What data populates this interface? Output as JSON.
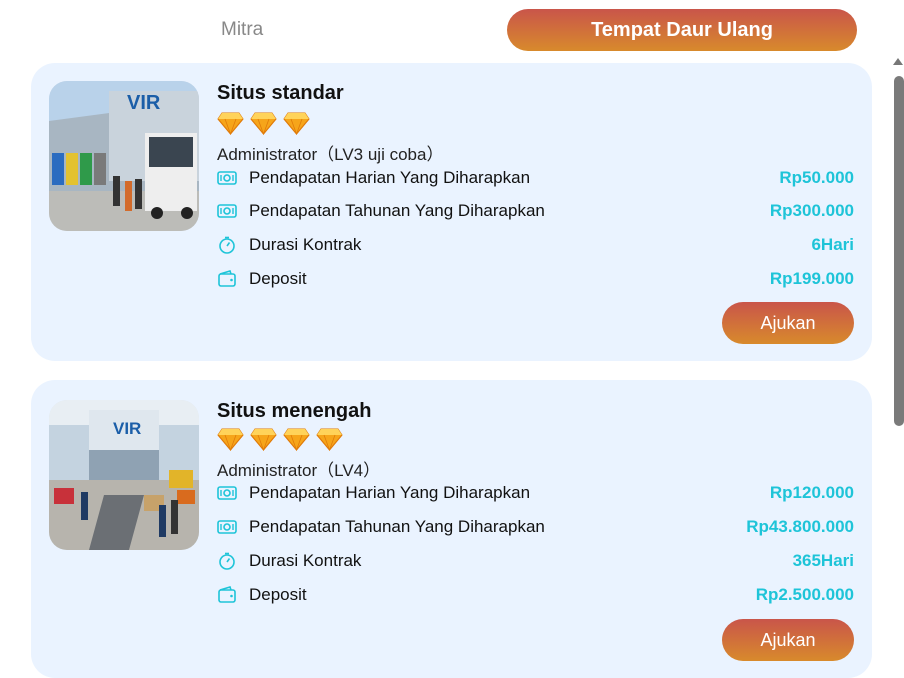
{
  "tabs": {
    "mitra": "Mitra",
    "recycling": "Tempat Daur Ulang"
  },
  "colors": {
    "accent_from": "#c9554a",
    "accent_to": "#d88a2c",
    "value": "#1ec4d8",
    "card_bg": "#eaf3ff"
  },
  "sites": [
    {
      "title": "Situs standar",
      "gems": 3,
      "admin": "Administrator（LV3 uji coba）",
      "rows": [
        {
          "icon": "cash-icon",
          "label": "Pendapatan Harian Yang Diharapkan",
          "value": "Rp50.000"
        },
        {
          "icon": "cash-icon",
          "label": "Pendapatan Tahunan Yang Diharapkan",
          "value": "Rp300.000"
        },
        {
          "icon": "timer-icon",
          "label": "Durasi Kontrak",
          "value": "6Hari"
        },
        {
          "icon": "wallet-icon",
          "label": "Deposit",
          "value": "Rp199.000"
        }
      ],
      "button": "Ajukan"
    },
    {
      "title": "Situs menengah",
      "gems": 4,
      "admin": "Administrator（LV4）",
      "rows": [
        {
          "icon": "cash-icon",
          "label": "Pendapatan Harian Yang Diharapkan",
          "value": "Rp120.000"
        },
        {
          "icon": "cash-icon",
          "label": "Pendapatan Tahunan Yang Diharapkan",
          "value": "Rp43.800.000"
        },
        {
          "icon": "timer-icon",
          "label": "Durasi Kontrak",
          "value": "365Hari"
        },
        {
          "icon": "wallet-icon",
          "label": "Deposit",
          "value": "Rp2.500.000"
        }
      ],
      "button": "Ajukan"
    }
  ]
}
